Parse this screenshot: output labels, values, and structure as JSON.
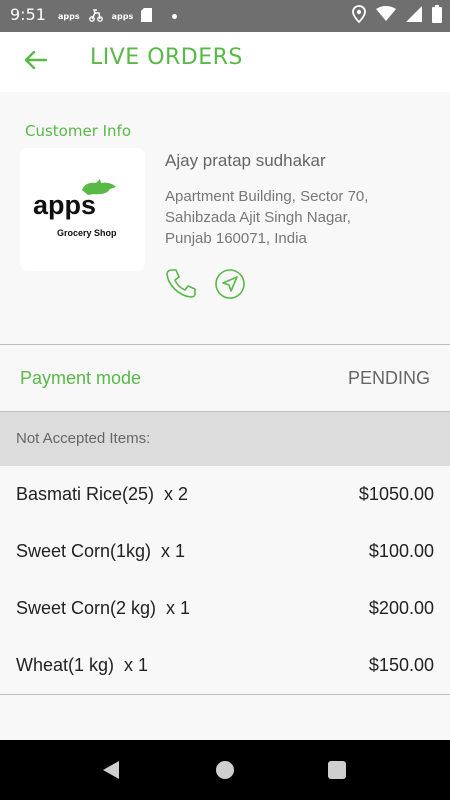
{
  "status_bar": {
    "time": "9:51",
    "left_icons": [
      {
        "text": "apps",
        "icon": "apps-notification-icon"
      },
      {
        "text": "",
        "icon": "delivery-notification-icon"
      },
      {
        "text": "apps",
        "icon": "apps-notification-icon"
      },
      {
        "text": "",
        "icon": "sd-card-icon"
      }
    ],
    "right_icons": [
      "location-icon",
      "wifi-icon",
      "signal-icon",
      "battery-icon"
    ]
  },
  "toolbar": {
    "back_icon": "arrow-left-icon",
    "title": "LIVE ORDERS",
    "accent_color": "#58b947"
  },
  "customer": {
    "section_label": "Customer Info",
    "logo": {
      "word": "apps",
      "subtitle": "Grocery Shop"
    },
    "name": "Ajay pratap sudhakar",
    "address_lines": [
      "Apartment Building, Sector 70,",
      "Sahibzada Ajit Singh Nagar,",
      "Punjab 160071, India"
    ],
    "actions": [
      {
        "icon": "phone-icon"
      },
      {
        "icon": "navigation-icon"
      }
    ]
  },
  "payment": {
    "label": "Payment mode",
    "value": "PENDING"
  },
  "items_section": {
    "header": "Not Accepted Items:",
    "items": [
      {
        "name": "Basmati Rice(25)  x 2",
        "price": "$1050.00"
      },
      {
        "name": "Sweet Corn(1kg)  x 1",
        "price": "$100.00"
      },
      {
        "name": "Sweet Corn(2 kg)  x 1",
        "price": "$200.00"
      },
      {
        "name": "Wheat(1 kg)  x 1",
        "price": "$150.00"
      }
    ]
  },
  "nav_bar": {
    "buttons": [
      "back-triangle-icon",
      "home-circle-icon",
      "recents-square-icon"
    ]
  }
}
